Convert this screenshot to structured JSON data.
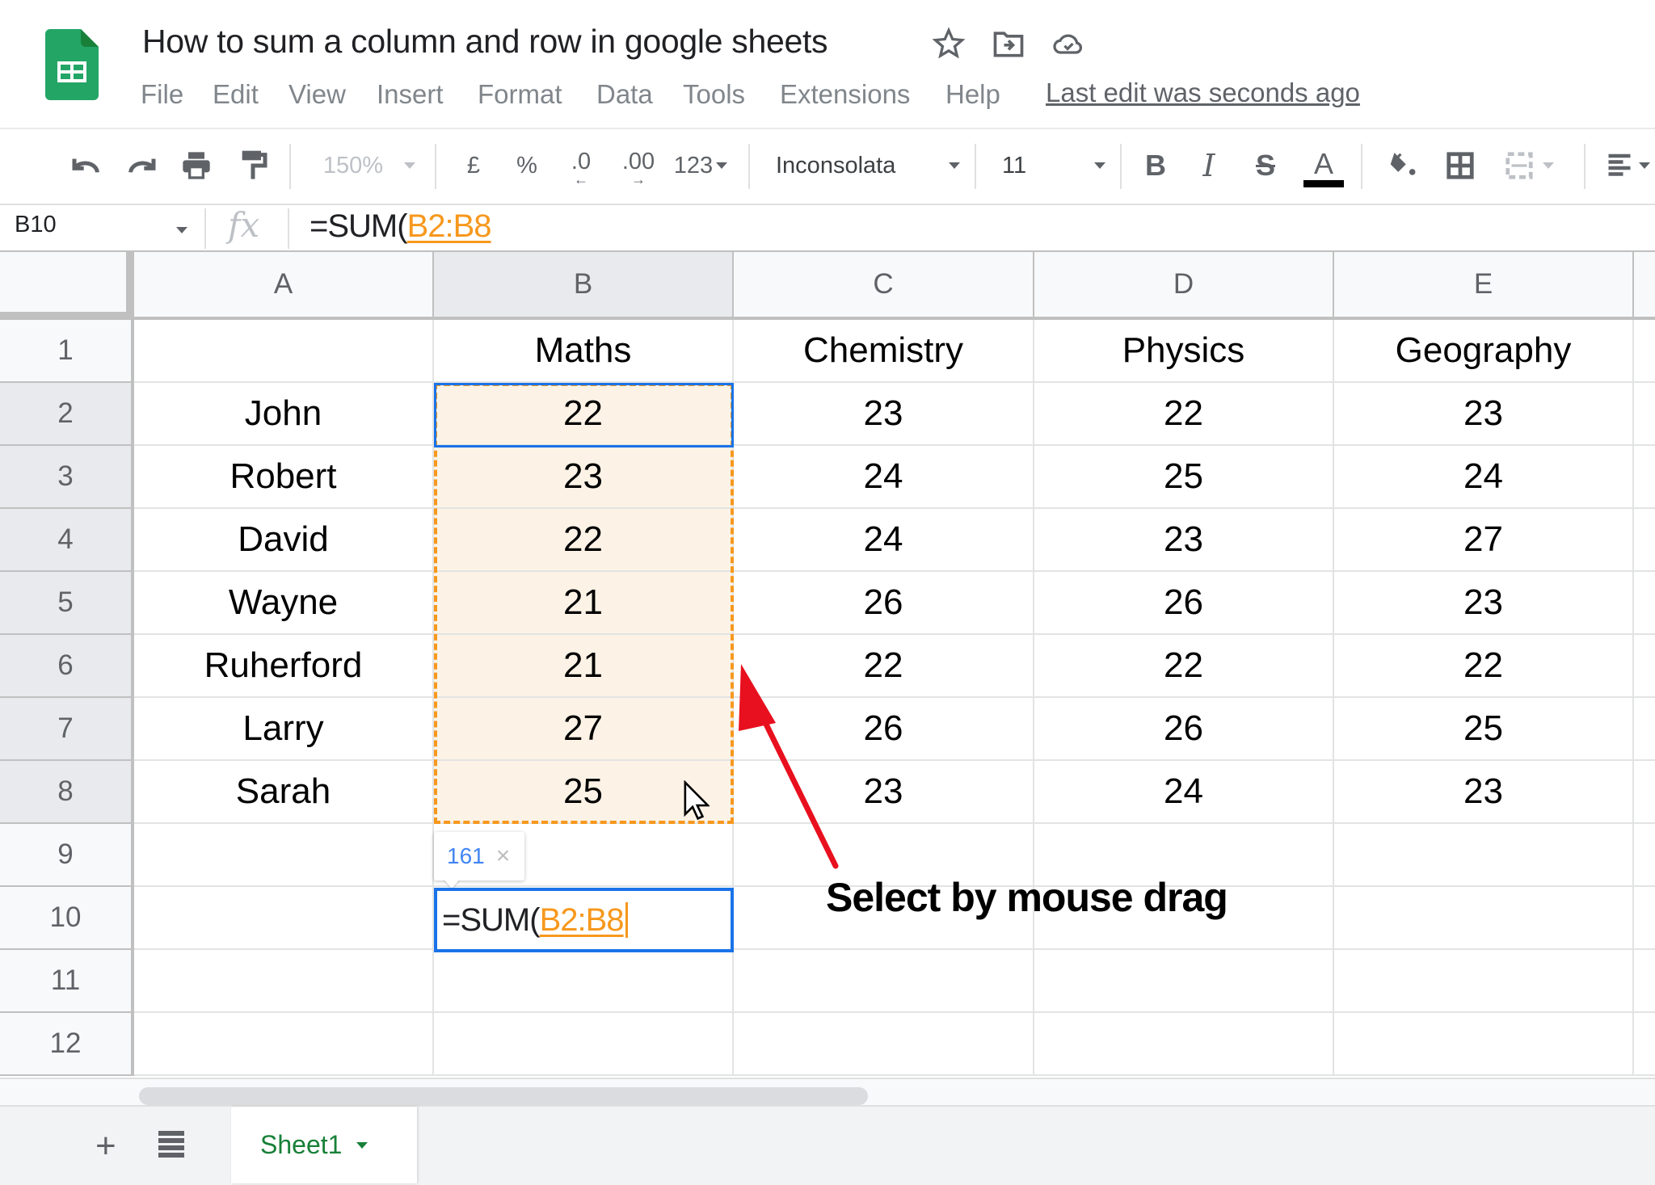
{
  "app": {
    "title": "How to sum a column and row in google sheets",
    "menu": [
      "File",
      "Edit",
      "View",
      "Insert",
      "Format",
      "Data",
      "Tools",
      "Extensions",
      "Help"
    ],
    "last_edit": "Last edit was seconds ago",
    "title_icons": [
      "star-icon",
      "move-to-folder-icon",
      "cloud-saved-icon"
    ]
  },
  "toolbar": {
    "zoom": "150%",
    "currency": "£",
    "percent": "%",
    "decrease_decimal": ".0",
    "increase_decimal": ".00",
    "more_formats": "123",
    "font": "Inconsolata",
    "font_size": "11",
    "bold": "B",
    "italic": "I",
    "strikethrough": "S",
    "text_color": "A",
    "text_color_value": "#000000"
  },
  "formula_bar": {
    "name_box": "B10",
    "fx": "fx",
    "formula_prefix": "=SUM(",
    "formula_ref": "B2:B8"
  },
  "sheet": {
    "columns": [
      "A",
      "B",
      "C",
      "D",
      "E",
      ""
    ],
    "rows": [
      "1",
      "2",
      "3",
      "4",
      "5",
      "6",
      "7",
      "8",
      "9",
      "10",
      "11",
      "12"
    ],
    "cells": [
      [
        "",
        "Maths",
        "Chemistry",
        "Physics",
        "Geography"
      ],
      [
        "John",
        "22",
        "23",
        "22",
        "23"
      ],
      [
        "Robert",
        "23",
        "24",
        "25",
        "24"
      ],
      [
        "David",
        "22",
        "24",
        "23",
        "27"
      ],
      [
        "Wayne",
        "21",
        "26",
        "26",
        "23"
      ],
      [
        "Ruherford",
        "21",
        "22",
        "22",
        "22"
      ],
      [
        "Larry",
        "27",
        "26",
        "26",
        "25"
      ],
      [
        "Sarah",
        "25",
        "23",
        "24",
        "23"
      ],
      [
        "",
        "",
        "",
        "",
        ""
      ],
      [
        "",
        "",
        "",
        "",
        ""
      ],
      [
        "",
        "",
        "",
        "",
        ""
      ],
      [
        "",
        "",
        "",
        "",
        ""
      ]
    ],
    "selected_range": "B2:B8",
    "active_cell": "B10",
    "editor_prefix": "=SUM(",
    "editor_ref": "B2:B8",
    "sum_preview": "161",
    "sum_preview_close": "×"
  },
  "annotation": {
    "text": "Select by mouse drag",
    "arrow_color": "#e8101e"
  },
  "tabs": {
    "add_label": "+",
    "sheets": [
      {
        "label": "Sheet1",
        "active": true
      }
    ]
  },
  "colors": {
    "accent_blue": "#1a73e8",
    "range_orange": "#f7981d",
    "sheet_green": "#188038",
    "range_fill": "#fcf3e6"
  }
}
